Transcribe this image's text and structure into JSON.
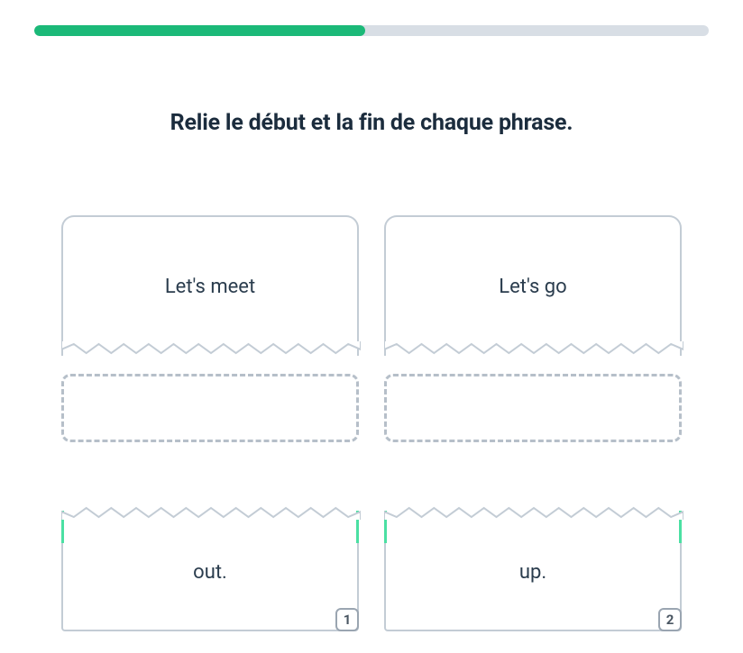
{
  "progress": {
    "percent": 49
  },
  "instruction": "Relie le début et la fin de chaque phrase.",
  "prompts": [
    {
      "text": "Let's meet"
    },
    {
      "text": "Let's go"
    }
  ],
  "choices": [
    {
      "text": "out.",
      "key": "1"
    },
    {
      "text": "up.",
      "key": "2"
    }
  ],
  "colors": {
    "progress_fill": "#1bb978",
    "progress_bg": "#d8dee5",
    "accent": "#4be0a3",
    "border": "#c3ccd5",
    "dashed": "#b6bfc9",
    "text": "#1b2c3d"
  }
}
